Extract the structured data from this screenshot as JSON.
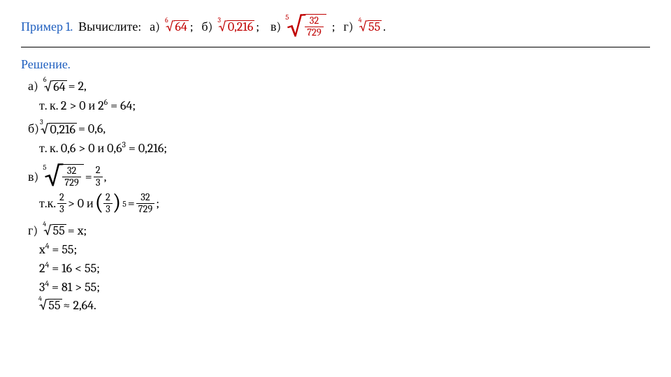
{
  "header": {
    "example_label": "Пример 1.",
    "task_word": "Вычислите:",
    "parts": {
      "a": {
        "letter": "а)",
        "idx": "6",
        "rad": "64",
        "after": ";"
      },
      "b": {
        "letter": "б)",
        "idx": "3",
        "rad": "0,216",
        "after": ";"
      },
      "v": {
        "letter": "в)",
        "idx": "5",
        "num": "32",
        "den": "729",
        "after": ";"
      },
      "g": {
        "letter": "г)",
        "idx": "4",
        "rad": "55",
        "after": "."
      }
    }
  },
  "solution_label": "Решение.",
  "sol": {
    "a": {
      "l1_letter": "а)",
      "l1_idx": "6",
      "l1_rad": "64",
      "l1_eq": " = 2,",
      "l2": "т. к. 2 > 0 и 2",
      "l2_sup": "6",
      "l2_tail": " = 64;"
    },
    "b": {
      "l1_letter": "б)",
      "l1_idx": "3",
      "l1_rad": "0,216",
      "l1_eq": " = 0,6,",
      "l2": "т. к. 0,6 > 0 и 0,6",
      "l2_sup": "3",
      "l2_tail": " = 0,216;"
    },
    "v": {
      "l1_letter": "в)",
      "l1_idx": "5",
      "l1_num": "32",
      "l1_den": "729",
      "l1_eq": " = ",
      "l1_rn": "2",
      "l1_rd": "3",
      "l1_tail": " ,",
      "l2_pre": "т.к. ",
      "l2_fn": "2",
      "l2_fd": "3",
      "l2_mid": " > 0 и ",
      "l2_pn": "2",
      "l2_pd": "3",
      "l2_exp": "5",
      "l2_eq": " = ",
      "l2_rn": "32",
      "l2_rd": "729",
      "l2_tail": " ;"
    },
    "g": {
      "l1_letter": "г)",
      "l1_idx": "4",
      "l1_rad": "55",
      "l1_eq": " = x;",
      "l2": "x",
      "l2_sup": "4",
      "l2_tail": " = 55;",
      "l3": "2",
      "l3_sup": "4",
      "l3_tail": " = 16 < 55;",
      "l4": "3",
      "l4_sup": "4",
      "l4_tail": " = 81 > 55;",
      "l5_idx": "4",
      "l5_rad": "55",
      "l5_tail": " ≈ 2,64."
    }
  }
}
